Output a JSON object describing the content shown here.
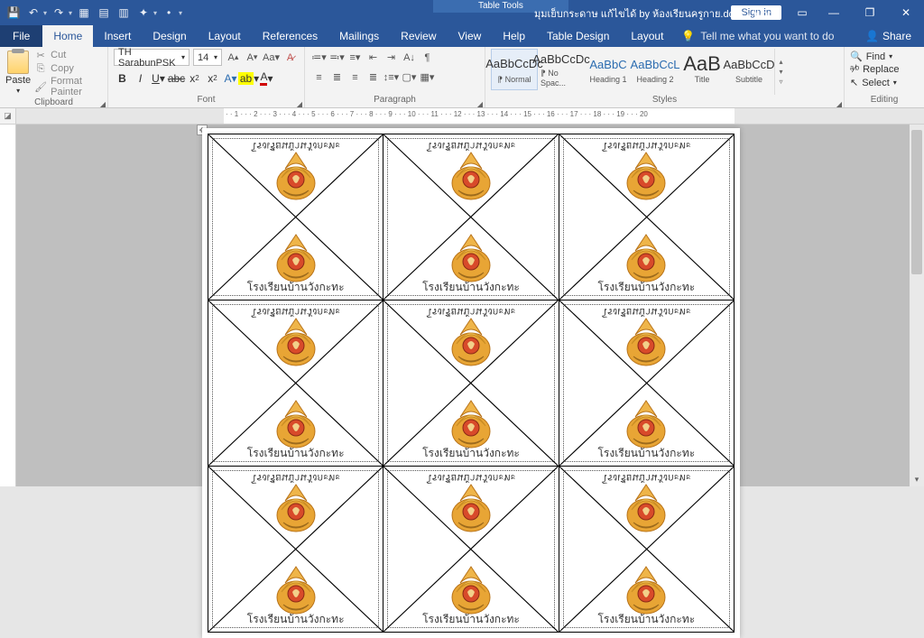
{
  "title_context": "Table Tools",
  "doc_title": "มุมเย็บกระดาษ แก้ไขได้ by ห้องเรียนครูกาย.docx  -  Word",
  "sign_in": "Sign in",
  "tabs": {
    "file": "File",
    "home": "Home",
    "insert": "Insert",
    "design": "Design",
    "layout": "Layout",
    "references": "References",
    "mailings": "Mailings",
    "review": "Review",
    "view": "View",
    "help": "Help",
    "table_design": "Table Design",
    "table_layout": "Layout"
  },
  "tell_me": "Tell me what you want to do",
  "share": "Share",
  "clipboard": {
    "paste": "Paste",
    "cut": "Cut",
    "copy": "Copy",
    "format_painter": "Format Painter",
    "label": "Clipboard"
  },
  "font": {
    "name": "TH SarabunPSK",
    "size": "14",
    "label": "Font"
  },
  "paragraph": {
    "label": "Paragraph"
  },
  "styles": {
    "label": "Styles",
    "items": [
      {
        "preview": "AaBbCcDc",
        "label": "⁋ Normal",
        "selected": true
      },
      {
        "preview": "AaBbCcDc",
        "label": "⁋ No Spac..."
      },
      {
        "preview": "AaBbC",
        "label": "Heading 1",
        "blue": true
      },
      {
        "preview": "AaBbCcL",
        "label": "Heading 2",
        "blue": true
      },
      {
        "preview": "AaB",
        "label": "Title",
        "big": true
      },
      {
        "preview": "AaBbCcD",
        "label": "Subtitle"
      }
    ]
  },
  "editing": {
    "find": "Find",
    "replace": "Replace",
    "select": "Select",
    "label": "Editing"
  },
  "ruler_scale": "· · 1 · · · 2 · · · 3 · · · 4 · · · 5 · · · 6 · · · 7 · · · 8 · · · 9 · · · 10 · · · 11 · · · 12 · · · 13 · · · 14 · · · 15 · · · 16 · · · 17 · · · 18 · · · 19 · ·  · 20",
  "cell": {
    "top_text": "โรงเรียนบ้านวังกะทะ",
    "bottom_text": "โรงเรียนบ้านวังกะทะ"
  }
}
